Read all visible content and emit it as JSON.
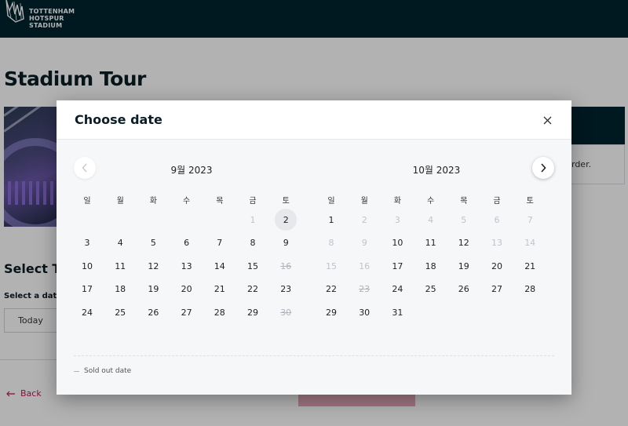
{
  "header": {
    "logo_lines": [
      "TOTTENHAM",
      "HOTSPUR",
      "STADIUM"
    ]
  },
  "page": {
    "title": "Stadium Tour",
    "select_tickets": "Select Tickets",
    "select_date_label": "Select a date",
    "today_button": "Today",
    "right_box_text": "rder.",
    "back_link": "Back"
  },
  "modal": {
    "title": "Choose date",
    "close_label": "×",
    "prev_label": "‹",
    "next_label": "›",
    "legend": "Sold out date",
    "weekdays": [
      "일",
      "월",
      "화",
      "수",
      "목",
      "금",
      "토"
    ],
    "months": [
      {
        "title": "9월 2023",
        "weeks": [
          [
            null,
            null,
            null,
            null,
            null,
            {
              "d": "1",
              "s": "disabled"
            },
            {
              "d": "2",
              "s": "selected"
            }
          ],
          [
            {
              "d": "3"
            },
            {
              "d": "4"
            },
            {
              "d": "5"
            },
            {
              "d": "6"
            },
            {
              "d": "7"
            },
            {
              "d": "8"
            },
            {
              "d": "9"
            }
          ],
          [
            {
              "d": "10"
            },
            {
              "d": "11"
            },
            {
              "d": "12"
            },
            {
              "d": "13"
            },
            {
              "d": "14"
            },
            {
              "d": "15"
            },
            {
              "d": "16",
              "s": "soldout"
            }
          ],
          [
            {
              "d": "17"
            },
            {
              "d": "18"
            },
            {
              "d": "19"
            },
            {
              "d": "20"
            },
            {
              "d": "21"
            },
            {
              "d": "22"
            },
            {
              "d": "23"
            }
          ],
          [
            {
              "d": "24"
            },
            {
              "d": "25"
            },
            {
              "d": "26"
            },
            {
              "d": "27"
            },
            {
              "d": "28"
            },
            {
              "d": "29"
            },
            {
              "d": "30",
              "s": "soldout"
            }
          ]
        ]
      },
      {
        "title": "10월 2023",
        "weeks": [
          [
            {
              "d": "1"
            },
            {
              "d": "2",
              "s": "disabled"
            },
            {
              "d": "3",
              "s": "disabled"
            },
            {
              "d": "4",
              "s": "disabled"
            },
            {
              "d": "5",
              "s": "disabled"
            },
            {
              "d": "6",
              "s": "disabled"
            },
            {
              "d": "7",
              "s": "disabled"
            }
          ],
          [
            {
              "d": "8",
              "s": "disabled"
            },
            {
              "d": "9",
              "s": "disabled"
            },
            {
              "d": "10"
            },
            {
              "d": "11"
            },
            {
              "d": "12"
            },
            {
              "d": "13",
              "s": "disabled"
            },
            {
              "d": "14",
              "s": "disabled"
            }
          ],
          [
            {
              "d": "15",
              "s": "disabled"
            },
            {
              "d": "16",
              "s": "disabled"
            },
            {
              "d": "17"
            },
            {
              "d": "18"
            },
            {
              "d": "19"
            },
            {
              "d": "20"
            },
            {
              "d": "21"
            }
          ],
          [
            {
              "d": "22"
            },
            {
              "d": "23",
              "s": "soldout"
            },
            {
              "d": "24"
            },
            {
              "d": "25"
            },
            {
              "d": "26"
            },
            {
              "d": "27"
            },
            {
              "d": "28"
            }
          ],
          [
            {
              "d": "29"
            },
            {
              "d": "30"
            },
            {
              "d": "31"
            },
            null,
            null,
            null,
            null
          ]
        ]
      }
    ]
  },
  "colors": {
    "header_bg": "#00232f",
    "accent_pink": "#c2185b",
    "selected_bg": "#e6e8eb"
  }
}
